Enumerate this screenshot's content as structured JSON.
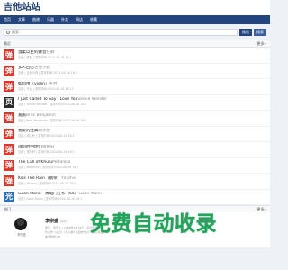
{
  "header": {
    "logo": "吉他站站"
  },
  "nav": {
    "items": [
      "首页",
      "文章",
      "曲谱",
      "乐器",
      "外卖",
      "网店",
      "收藏"
    ]
  },
  "search": {
    "placeholder": "搜索",
    "button1": "搜站",
    "button2": "搜索"
  },
  "list_section": {
    "title": "最近",
    "more": "更多»"
  },
  "songs": [
    {
      "icon": "弹",
      "color": "red",
      "title": "温柔以主的颤音",
      "artist": "任静",
      "meta": "吉他 | 任静 | 发布时间:2024-06-16 14:1"
    },
    {
      "icon": "弹",
      "color": "red",
      "title": "多人回忆",
      "artist": "吉他小叙",
      "meta": "吉他 | 吉他小叙 | 发布时间:2024-06-16 16:1"
    },
    {
      "icon": "弹",
      "color": "red",
      "title": "如何用（violin）",
      "artist": "平台",
      "meta": "吉他 | 平台 | 发布时间:2024-06-16 16:17"
    },
    {
      "icon": "页",
      "color": "dark",
      "title": "I Just Called To Say I Love You",
      "artist": "Stevie Wonder",
      "meta": "吉他 | Stevie Wonder | 发布时间:2024-06-16 16:1"
    },
    {
      "icon": "弹",
      "color": "red",
      "title": "爱盖",
      "artist": "Brec Benjamin",
      "meta": "吉他 | Brec Benjamin | 发布时间:2024-06-16 16:1"
    },
    {
      "icon": "弹",
      "color": "red",
      "title": "我爱的经典",
      "artist": "周杰伦",
      "meta": "吉他 | 周杰伦 | 发布时间:2024-06-16 16:1"
    },
    {
      "icon": "弹",
      "color": "red",
      "title": "旅何时回你们",
      "artist": "张敬轩",
      "meta": "吉他 | 张敬轩 | 发布时间:2024-06-16 16:1"
    },
    {
      "icon": "弹",
      "color": "red",
      "title": "The Call of Khulu",
      "artist": "Metallica",
      "meta": "吉他 | Metallica | 发布时间:2024-06-16 16:1"
    },
    {
      "icon": "弹",
      "color": "red",
      "title": "Kiss The Rain（钢琴）",
      "artist": "Yiruma",
      "meta": "吉他 | Yiruma | 发布时间:2024-06-16 16:1"
    },
    {
      "icon": "光",
      "color": "blue",
      "title": "Gaan Mann一周电门在作（56）",
      "artist": "Gaan Mann",
      "meta": "吉他 | Gaan Mann | 发布时间:2024-06-16 16:1"
    }
  ],
  "bottom_section": {
    "title": "热门",
    "more": "更多»"
  },
  "profile": {
    "avatar_caption": "李宗盛",
    "name": "李宗盛",
    "name_sub": "音乐人",
    "line1": "歌手、音乐人 | 1958年7月19日 | 台湾省新北市",
    "line2": "代表作《山丘》《凡人歌》《爱的代价》《真心英雄》等",
    "line3": "曲谱数量:18"
  },
  "watermark": "免费自动收录",
  "colors": {
    "nav": "#23457d",
    "accent_green": "#1fa65a",
    "thumb_red": "#d9382c"
  }
}
